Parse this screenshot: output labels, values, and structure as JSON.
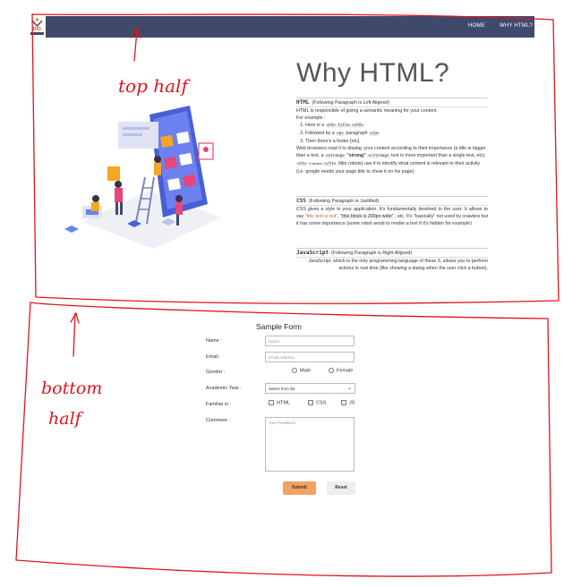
{
  "nav": {
    "logo_text": "RID",
    "links": [
      {
        "label": "HOME"
      },
      {
        "label": "WHY HTML?"
      }
    ]
  },
  "annotations": {
    "top": "top half",
    "bottom_line1": "bottom",
    "bottom_line2": "half"
  },
  "hero": {
    "title": "Why HTML?"
  },
  "html_section": {
    "keyword": "HTML",
    "note": "(Following Paragraph is Left Aligned)",
    "line1": "HTML is responsible of giving a semantic meaning for your content.",
    "line2": "For example :",
    "items": [
      {
        "pre": "Here is a ",
        "code": "<h5> title </h5>",
        "post": ""
      },
      {
        "pre": "Followed by a ",
        "code": "<p>",
        "mid": " paragraph ",
        "code2": "</p>"
      },
      {
        "pre": "Then there's a footer [etc]."
      }
    ],
    "para_a": "Web browsers read it to display your content according to their importance (a title is bigger than a text, a ",
    "para_code1": "<strong>",
    "para_strong": " \"strong\" ",
    "para_code2": "</strong>",
    "para_b": " text is more important than a single text, etc). ",
    "para_code3": "<tt>",
    "para_crawlers": " Crawlers ",
    "para_code4": "</tt>",
    "para_c": " (like robots) use it to identify what content is relevant to their activity (i.e. google needs your page title to show it on his page)."
  },
  "css_section": {
    "keyword": "CSS",
    "note": "(Following Paragraph is Justified)",
    "text_a": "CSS gives a style to your application. It's fundamentally destined to the user. It allows to say ",
    "text_red": "\"this text is red\"",
    "text_b": ", ",
    "text_bold": "\"this block is 200px wide\"",
    "text_c": " , etc. It's \"basically\" not used by crawlers but it has some importance (some robot avoid to render a text if it's hidden for example)"
  },
  "js_section": {
    "keyword": "JavaScript",
    "note": "(Following Paragraph is Right Aligned)",
    "text": "JavaScript, which is the only programming language of these 3, allows you to perform actions in real time (like showing a dialog when the user click a button)."
  },
  "form": {
    "title": "Sample Form",
    "name_label": "Name :",
    "name_placeholder": "Name",
    "email_label": "Email :",
    "email_placeholder": "Email Address",
    "gender_label": "Gender :",
    "gender_options": [
      "Male",
      "Female"
    ],
    "year_label": "Academic Year :",
    "year_selected": "Select from list",
    "familiar_label": "Familiar in :",
    "familiar_options": [
      "HTML",
      "CSS",
      "JS"
    ],
    "comment_label": "Comment :",
    "comment_placeholder": "Your Feedback",
    "submit_label": "Submit",
    "reset_label": "Reset"
  },
  "colors": {
    "navbar": "#3f4a6b",
    "submit": "#f4a261",
    "annotation": "#e0141e"
  }
}
